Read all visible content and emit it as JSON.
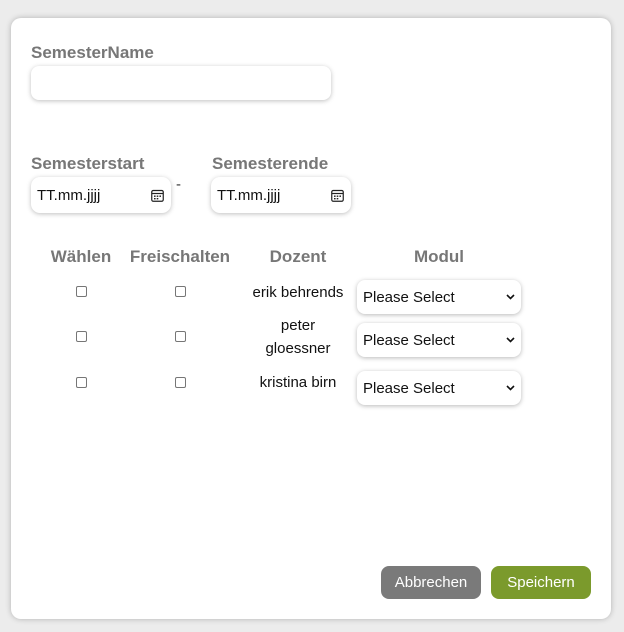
{
  "form": {
    "semester_name_label": "SemesterName",
    "semester_name_value": "",
    "semester_start_label": "Semesterstart",
    "semester_start_placeholder": "TT.mm.jjjj",
    "range_separator": "-",
    "semester_end_label": "Semesterende",
    "semester_end_placeholder": "TT.mm.jjjj"
  },
  "table": {
    "headers": [
      "Wählen",
      "Freischalten",
      "Dozent",
      "Modul"
    ],
    "rows": [
      {
        "dozent": "erik behrends",
        "waehlen_checked": false,
        "freischalten_checked": false,
        "modul": "Please Select"
      },
      {
        "dozent": "peter gloessner",
        "waehlen_checked": false,
        "freischalten_checked": false,
        "modul": "Please Select"
      },
      {
        "dozent": "kristina birn",
        "waehlen_checked": false,
        "freischalten_checked": false,
        "modul": "Please Select"
      }
    ]
  },
  "actions": {
    "cancel_label": "Abbrechen",
    "save_label": "Speichern"
  },
  "colors": {
    "cancel": "#7a7a7a",
    "save": "#7b9a2c",
    "label": "#777777"
  },
  "icons": [
    "calendar-icon",
    "chevron-down-icon"
  ]
}
